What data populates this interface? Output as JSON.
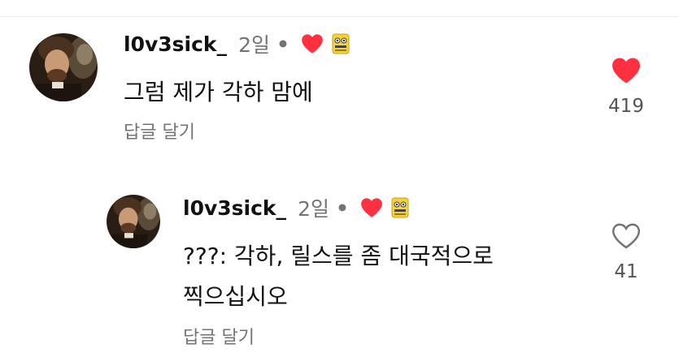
{
  "comments": [
    {
      "username": "l0v3sick_",
      "time": "2일",
      "separator": "•",
      "lines": [
        "그럼 제가 각하 맘에"
      ],
      "reply_label": "답글 달기",
      "likes": "419",
      "liked": true
    },
    {
      "username": "l0v3sick_",
      "time": "2일",
      "separator": "•",
      "lines": [
        "???: 각하, 릴스를 좀 대국적으로",
        "찍으십시오"
      ],
      "reply_label": "답글 달기",
      "likes": "41",
      "liked": false
    }
  ],
  "colors": {
    "heart_red": "#ff3040",
    "muted_text": "#737373",
    "sticker_yellow": "#f4d33a"
  },
  "icons": {
    "author_heart": "heart-filled-icon",
    "like_filled": "heart-filled-icon",
    "like_outline": "heart-outline-icon",
    "sticker": "sticker-badge-icon"
  }
}
